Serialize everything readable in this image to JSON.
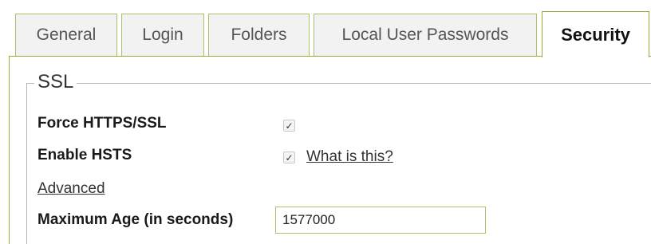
{
  "tabs": [
    {
      "label": "General",
      "active": false
    },
    {
      "label": "Login",
      "active": false
    },
    {
      "label": "Folders",
      "active": false
    },
    {
      "label": "Local User Passwords",
      "active": false
    },
    {
      "label": "Security",
      "active": true
    }
  ],
  "ssl_section": {
    "legend": "SSL",
    "force_https": {
      "label": "Force HTTPS/SSL",
      "checked": true
    },
    "enable_hsts": {
      "label": "Enable HSTS",
      "checked": true,
      "help_link": "What is this?"
    },
    "advanced_link": "Advanced",
    "max_age": {
      "label": "Maximum Age (in seconds)",
      "value": "1577000"
    }
  },
  "colors": {
    "tab_border": "#a8c26a",
    "active_border": "#8db035",
    "tab_background": "#f2f2f2"
  }
}
